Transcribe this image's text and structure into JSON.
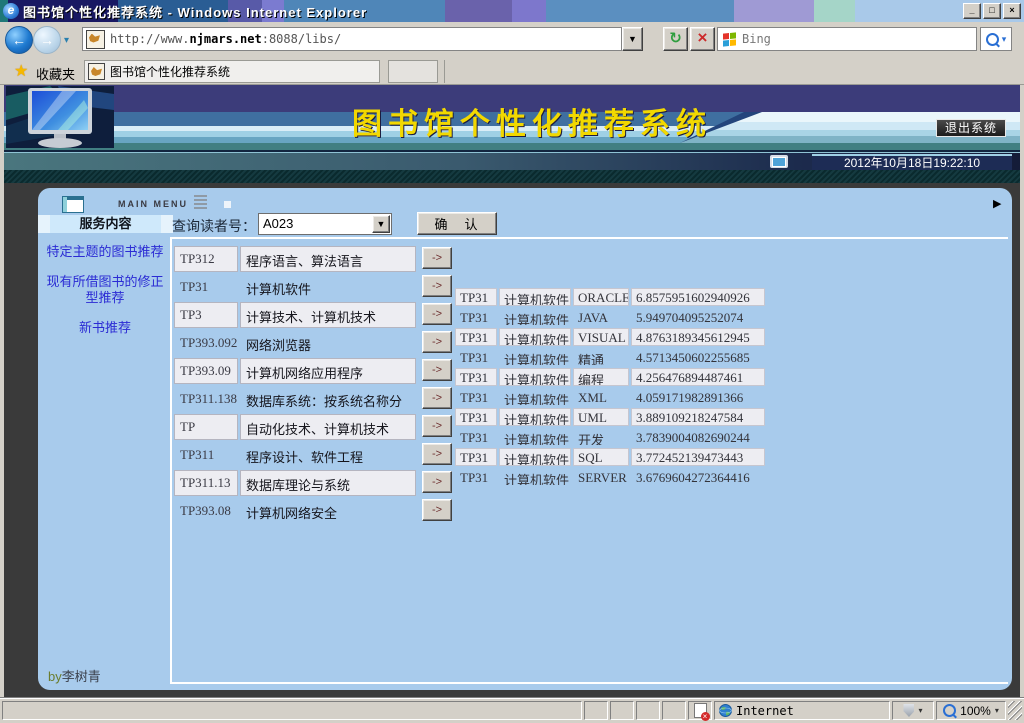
{
  "window": {
    "title": "图书馆个性化推荐系统 - Windows Internet Explorer",
    "controls": {
      "minimize": "_",
      "maximize": "□",
      "close": "×"
    }
  },
  "toolbar": {
    "back_icon": "←",
    "forward_icon": "→",
    "nav_chevron": "▾",
    "url_prefix": "http://www.",
    "url_domain": "njmars.net",
    "url_suffix": ":8088/libs/",
    "address_dropdown": "▼",
    "refresh_icon": "↻",
    "stop_icon": "×",
    "search_engine": "Bing",
    "search_chevron": "▾"
  },
  "favorites": {
    "label": "收藏夹",
    "tab_title": "图书馆个性化推荐系统"
  },
  "banner": {
    "title": "图书馆个性化推荐系统",
    "exit_button": "退出系统",
    "datetime": "2012年10月18日19:22:10"
  },
  "sidebar": {
    "main_menu": "MAIN MENU",
    "header": "服务内容",
    "items": [
      "特定主题的图书推荐",
      "现有所借图书的修正型推荐",
      "新书推荐"
    ],
    "credit_prefix": "by",
    "credit_name": "李树青"
  },
  "query": {
    "label": "查询读者号：",
    "value": "A023",
    "dropdown": "▼",
    "confirm": "确　认"
  },
  "panel_arrow": "▶",
  "category_table": {
    "button_label": "->",
    "rows": [
      {
        "code": "TP312",
        "label": "程序语言、算法语言"
      },
      {
        "code": "TP31",
        "label": "计算机软件"
      },
      {
        "code": "TP3",
        "label": "计算技术、计算机技术"
      },
      {
        "code": "TP393.092",
        "label": "网络浏览器"
      },
      {
        "code": "TP393.09",
        "label": "计算机网络应用程序"
      },
      {
        "code": "TP311.138",
        "label": "数据库系统：按系统名称分"
      },
      {
        "code": "TP",
        "label": "自动化技术、计算机技术"
      },
      {
        "code": "TP311",
        "label": "程序设计、软件工程"
      },
      {
        "code": "TP311.13",
        "label": "数据库理论与系统"
      },
      {
        "code": "TP393.08",
        "label": "计算机网络安全"
      }
    ]
  },
  "recommend_table": {
    "rows": [
      {
        "code": "TP31",
        "category": "计算机软件",
        "keyword": "ORACLE",
        "score": "6.8575951602940926"
      },
      {
        "code": "TP31",
        "category": "计算机软件",
        "keyword": "JAVA",
        "score": "5.949704095252074"
      },
      {
        "code": "TP31",
        "category": "计算机软件",
        "keyword": "VISUAL",
        "score": "4.8763189345612945"
      },
      {
        "code": "TP31",
        "category": "计算机软件",
        "keyword": "精通",
        "score": "4.5713450602255685"
      },
      {
        "code": "TP31",
        "category": "计算机软件",
        "keyword": "编程",
        "score": "4.256476894487461"
      },
      {
        "code": "TP31",
        "category": "计算机软件",
        "keyword": "XML",
        "score": "4.059171982891366"
      },
      {
        "code": "TP31",
        "category": "计算机软件",
        "keyword": "UML",
        "score": "3.889109218247584"
      },
      {
        "code": "TP31",
        "category": "计算机软件",
        "keyword": "开发",
        "score": "3.7839004082690244"
      },
      {
        "code": "TP31",
        "category": "计算机软件",
        "keyword": "SQL",
        "score": "3.772452139473443"
      },
      {
        "code": "TP31",
        "category": "计算机软件",
        "keyword": "SERVER",
        "score": "3.6769604272364416"
      }
    ]
  },
  "status_bar": {
    "zone": "Internet",
    "zoom": "100%",
    "shield_chevron": "▾",
    "zoom_chevron": "▾"
  },
  "colors": {
    "content_bg": "#a8cbec",
    "banner_title": "#f2d800",
    "link_blue": "#2b2bd4",
    "cell_bg": "#ededf2",
    "page_bg": "#3a3a3a",
    "chrome": "#d4d0c8",
    "date_panel": "#1d2c55",
    "exit_button_bg": "#1c1c1c"
  }
}
